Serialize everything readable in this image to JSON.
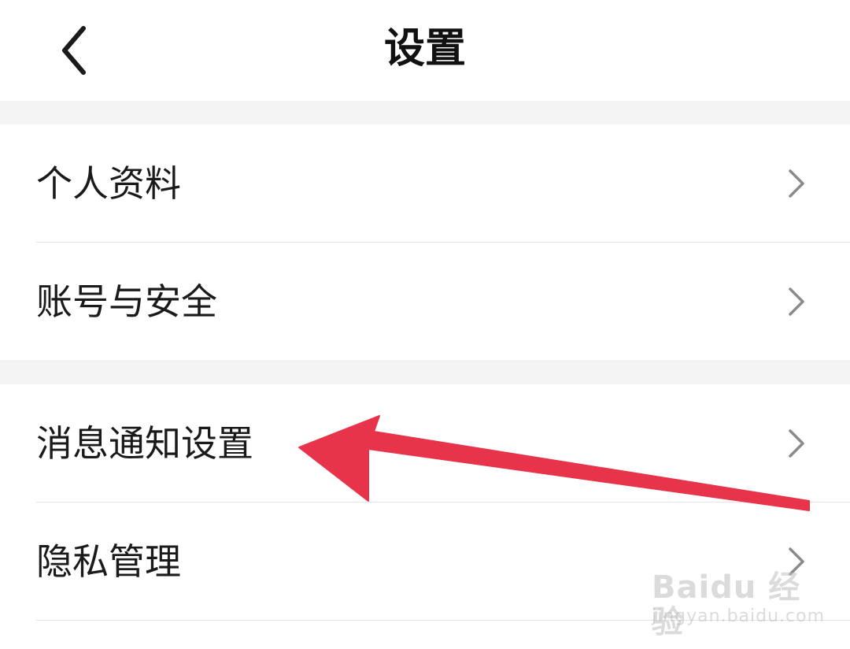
{
  "header": {
    "title": "设置",
    "back_icon": "chevron-left-icon"
  },
  "groups": [
    {
      "items": [
        {
          "label": "个人资料",
          "icon": "chevron-right-icon"
        },
        {
          "label": "账号与安全",
          "icon": "chevron-right-icon"
        }
      ]
    },
    {
      "items": [
        {
          "label": "消息通知设置",
          "icon": "chevron-right-icon"
        },
        {
          "label": "隐私管理",
          "icon": "chevron-right-icon"
        }
      ]
    }
  ],
  "annotation": {
    "type": "arrow",
    "color": "#e8344a",
    "points_to": "消息通知设置"
  },
  "watermark": {
    "brand": "Baidu 经验",
    "url": "jingyan.baidu.com"
  },
  "colors": {
    "background": "#ffffff",
    "section_gap": "#f4f4f4",
    "text": "#1a1a1a",
    "chevron": "#8a8a8a",
    "divider": "#e3e3e3"
  }
}
